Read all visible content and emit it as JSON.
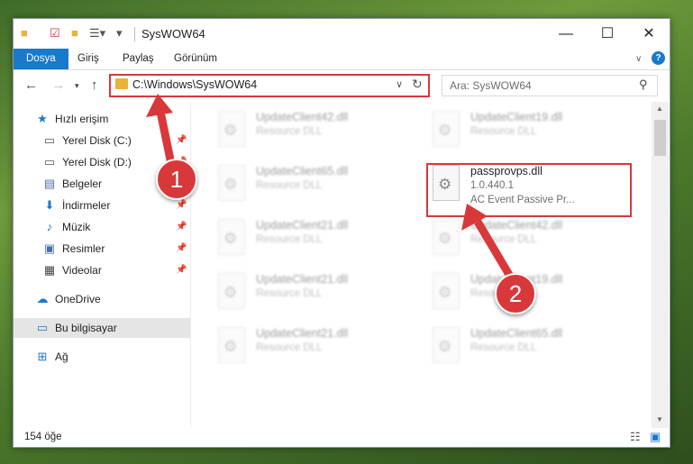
{
  "window": {
    "title": "SysWOW64"
  },
  "titlebar": {
    "minimize": "—",
    "maximize": "☐",
    "close": "✕"
  },
  "ribbon": {
    "tabs": [
      "Dosya",
      "Giriş",
      "Paylaş",
      "Görünüm"
    ],
    "help": "?"
  },
  "address": {
    "path": "C:\\Windows\\SysWOW64",
    "search_placeholder": "Ara: SysWOW64"
  },
  "sidebar": {
    "items": [
      {
        "label": "Hızlı erişim",
        "icon": "star-icon"
      },
      {
        "label": "Yerel Disk (C:)",
        "icon": "drive-icon"
      },
      {
        "label": "Yerel Disk (D:)",
        "icon": "drive-icon"
      },
      {
        "label": "Belgeler",
        "icon": "documents-icon"
      },
      {
        "label": "İndirmeler",
        "icon": "download-icon"
      },
      {
        "label": "Müzik",
        "icon": "music-icon"
      },
      {
        "label": "Resimler",
        "icon": "pictures-icon"
      },
      {
        "label": "Videolar",
        "icon": "video-icon"
      },
      {
        "label": "OneDrive",
        "icon": "cloud-icon"
      },
      {
        "label": "Bu bilgisayar",
        "icon": "computer-icon"
      },
      {
        "label": "Ağ",
        "icon": "network-icon"
      }
    ]
  },
  "files": [
    {
      "name": "UpdateClient42.dll",
      "type": "Resource DLL"
    },
    {
      "name": "UpdateClient19.dll",
      "type": "Resource DLL"
    },
    {
      "name": "UpdateClient65.dll",
      "type": "Resource DLL"
    },
    {
      "name": "passprovps.dll",
      "version": "1.0.440.1",
      "description": "AC Event Passive Pr..."
    },
    {
      "name": "UpdateClient21.dll",
      "type": "Resource DLL"
    },
    {
      "name": "UpdateClient42.dll",
      "type": "Resource DLL"
    },
    {
      "name": "UpdateClient21.dll",
      "type": "Resource DLL"
    },
    {
      "name": "UpdateClient19.dll",
      "type": "Resource DLL"
    },
    {
      "name": "UpdateClient21.dll",
      "type": "Resource DLL"
    },
    {
      "name": "UpdateClient65.dll",
      "type": "Resource DLL"
    }
  ],
  "status": {
    "count": "154 öğe"
  },
  "callouts": [
    "1",
    "2"
  ],
  "colors": {
    "accent": "#1979ca",
    "highlight": "#d8383a"
  }
}
